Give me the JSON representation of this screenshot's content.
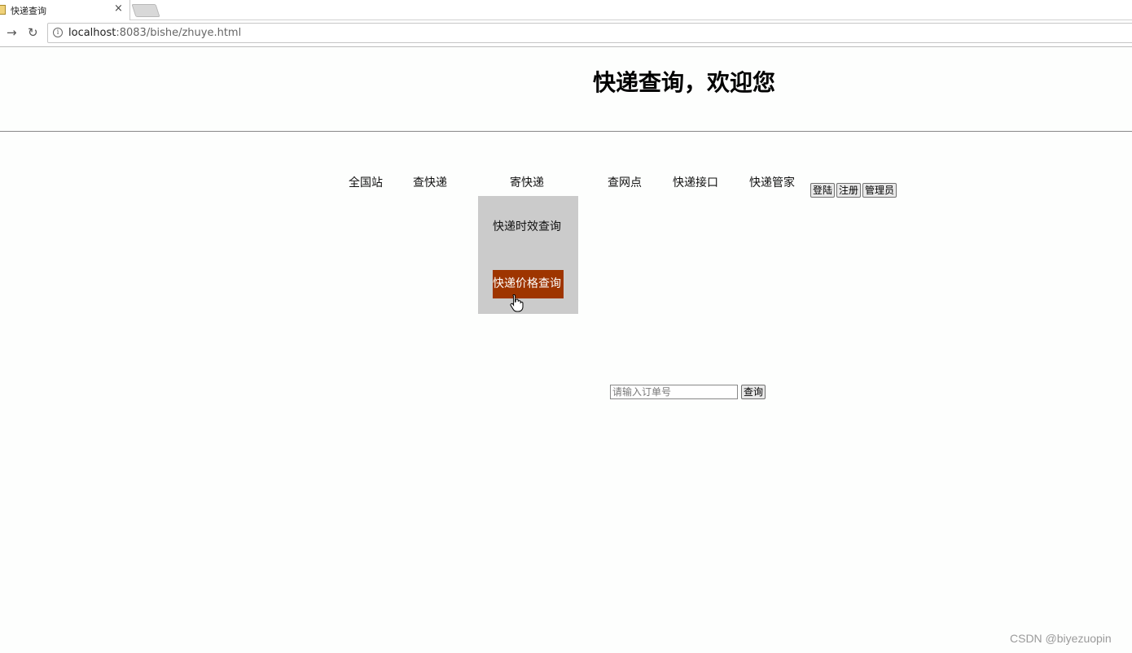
{
  "browser": {
    "tab_title": "快递查询",
    "tab_close": "×",
    "nav_forward": "→",
    "nav_reload": "↻",
    "url_host": "localhost",
    "url_rest": ":8083/bishe/zhuye.html"
  },
  "page": {
    "title": "快递查询，欢迎您"
  },
  "nav": {
    "items": [
      "全国站",
      "查快递",
      "寄快递",
      "查网点",
      "快递接口",
      "快递管家"
    ],
    "login_label": "登陆",
    "register_label": "注册",
    "admin_label": "管理员"
  },
  "dropdown": {
    "items": [
      "快递时效查询",
      "快递价格查询"
    ],
    "highlight_color": "#9e3500"
  },
  "search": {
    "placeholder": "请输入订单号",
    "button_label": "查询"
  },
  "watermark": {
    "text": "CSDN @biyezuopin"
  }
}
